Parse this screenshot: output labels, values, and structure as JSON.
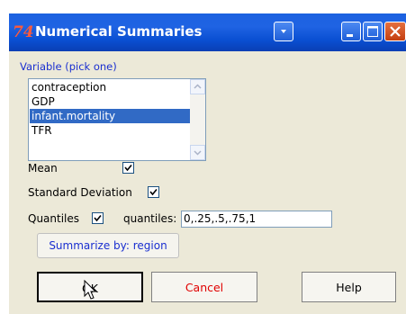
{
  "window": {
    "title": "Numerical Summaries",
    "app_icon": "74"
  },
  "variable": {
    "label": "Variable (pick one)",
    "items": [
      "contraception",
      "GDP",
      "infant.mortality",
      "TFR"
    ],
    "selected": "infant.mortality"
  },
  "options": {
    "mean_label": "Mean",
    "mean_checked": true,
    "sd_label": "Standard Deviation",
    "sd_checked": true,
    "quantiles_label": "Quantiles",
    "quantiles_checked": true,
    "quantiles_field_label": "quantiles:",
    "quantiles_value": "0,.25,.5,.75,1"
  },
  "buttons": {
    "summarize": "Summarize by: region",
    "ok": "OK",
    "cancel": "Cancel",
    "help": "Help"
  },
  "colors": {
    "title_bar": "#0a4fd2",
    "label_blue": "#1a2fd0",
    "cancel_red": "#e00000",
    "selection": "#316ac5"
  }
}
